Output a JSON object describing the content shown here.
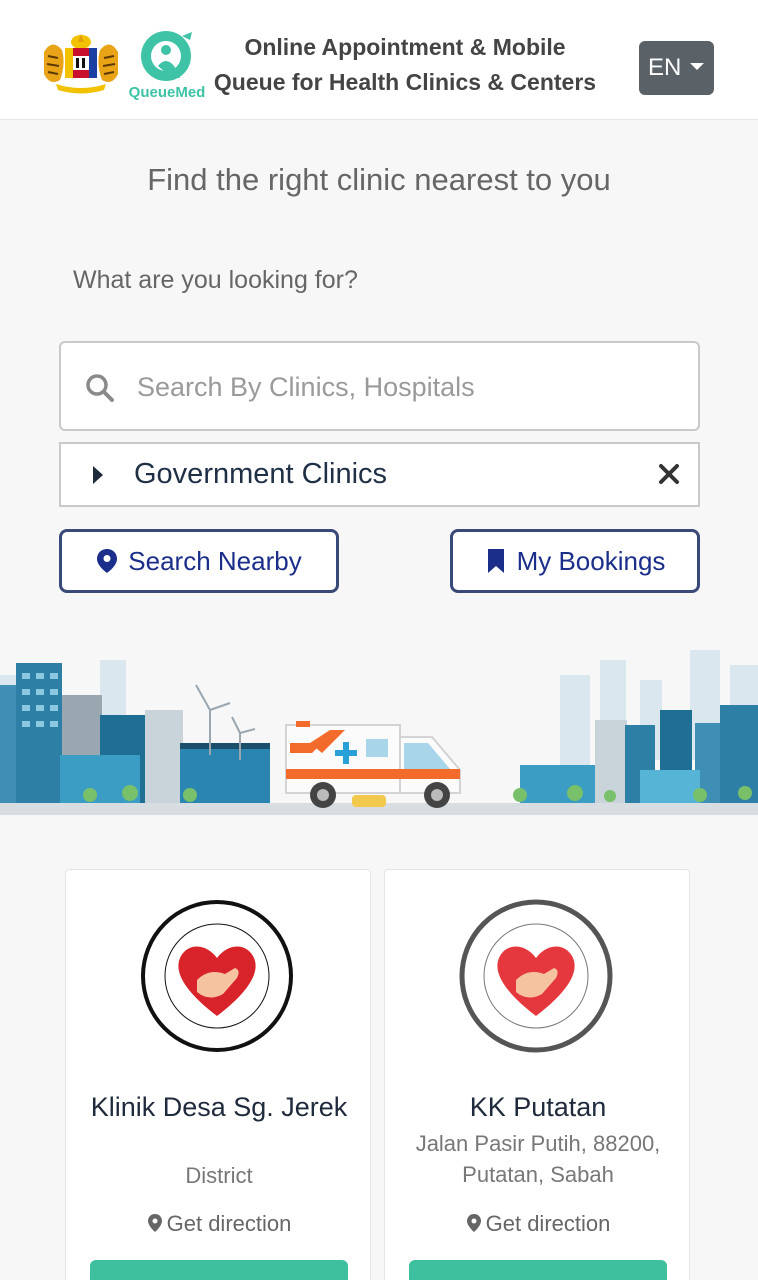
{
  "header": {
    "title_line1": "Online Appointment & Mobile",
    "title_line2": "Queue for Health Clinics & Centers",
    "brand": "QueueMed",
    "language": "EN"
  },
  "hero": {
    "title": "Find the right clinic nearest to you",
    "question": "What are you looking for?"
  },
  "search": {
    "placeholder": "Search By Clinics, Hospitals",
    "value": ""
  },
  "filter": {
    "label": "Government Clinics"
  },
  "actions": {
    "nearby_label": "Search Nearby",
    "bookings_label": "My Bookings"
  },
  "clinics": [
    {
      "name": "Klinik Desa Sg. Jerek",
      "address": "District",
      "direction_label": "Get direction"
    },
    {
      "name": "KK Putatan",
      "address": "Jalan Pasir Putih, 88200, Putatan, Sabah",
      "direction_label": "Get direction"
    }
  ],
  "colors": {
    "accent": "#3ebf9d",
    "primary_text": "#1a2e8a",
    "lang_button": "#5a6268"
  }
}
